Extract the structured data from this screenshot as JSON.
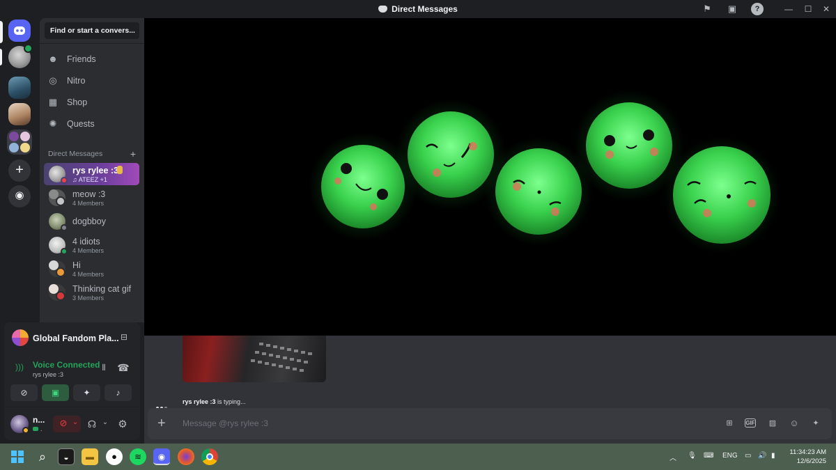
{
  "window": {
    "title": "Direct Messages"
  },
  "search": {
    "placeholder": "Find or start a convers..."
  },
  "nav": [
    {
      "label": "Friends",
      "icon": "friends-icon"
    },
    {
      "label": "Nitro",
      "icon": "nitro-icon"
    },
    {
      "label": "Shop",
      "icon": "shop-icon"
    },
    {
      "label": "Quests",
      "icon": "quests-icon"
    }
  ],
  "dm_section": {
    "heading": "Direct Messages",
    "add": "+"
  },
  "dms": [
    {
      "name": "rys rylee :3",
      "sub": "ATEEZ +1",
      "status": "dnd",
      "active": true
    },
    {
      "name": "meow :3",
      "sub": "4 Members"
    },
    {
      "name": "dogbboy",
      "sub": "",
      "status": "offline"
    },
    {
      "name": "4 idiots",
      "sub": "4 Members",
      "status": "online"
    },
    {
      "name": "Hi",
      "sub": "4 Members"
    },
    {
      "name": "Thinking cat gif",
      "sub": "3 Members"
    }
  ],
  "voice": {
    "server": "Global Fandom Pla...",
    "status": "Voice Connected",
    "channel": "rys rylee :3"
  },
  "user": {
    "name": "n...",
    "status_text": "."
  },
  "chat": {
    "typing_user": "rys rylee :3",
    "typing_suffix": " is typing...",
    "message_placeholder": "Message @rys rylee :3",
    "composer_icons": [
      "gift-icon",
      "gif-icon",
      "sticker-icon",
      "emoji-icon",
      "apps-icon"
    ],
    "gif_label": "GIF"
  },
  "taskbar": {
    "language": "ENG",
    "time": "11:34:23 AM",
    "date": "12/6/2025"
  },
  "colors": {
    "accent": "#5865f2",
    "online": "#23a55a",
    "dnd": "#f23f43",
    "voice_connected": "#23a55a",
    "taskbar": "#4d5f4f"
  }
}
